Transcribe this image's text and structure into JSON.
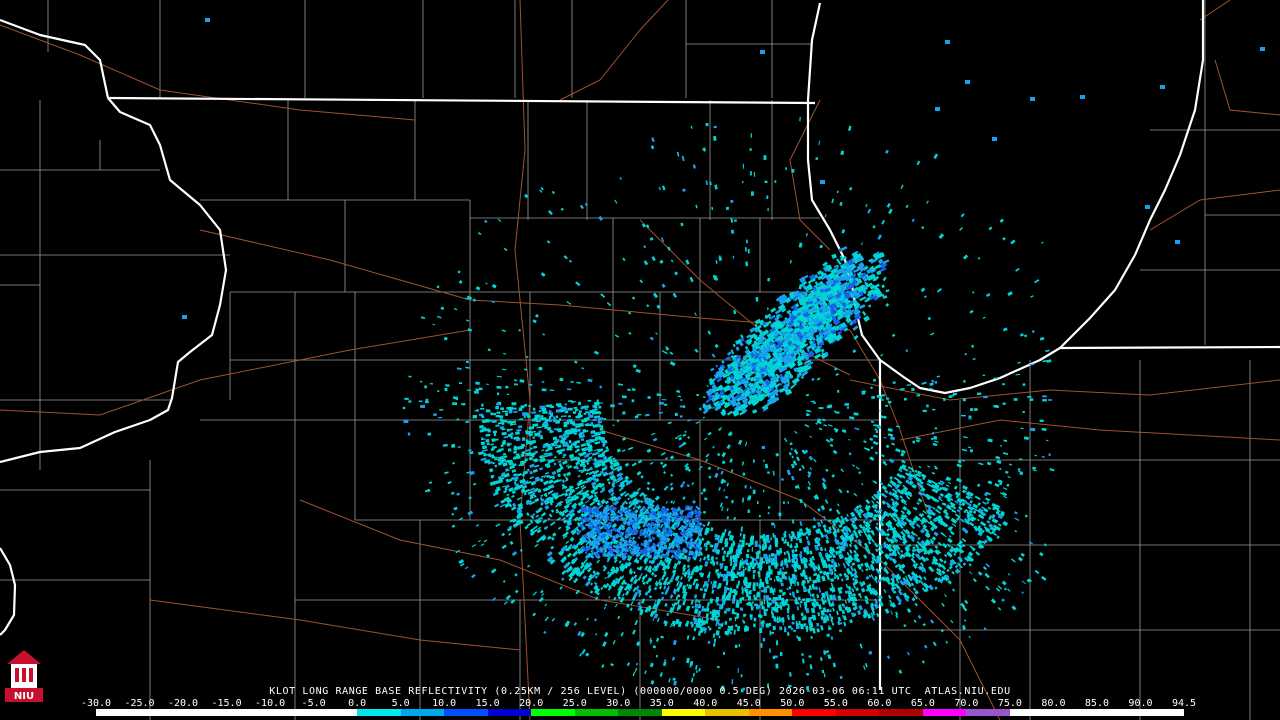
{
  "caption": "KLOT LONG RANGE BASE REFLECTIVITY (0.25KM / 256 LEVEL) (000000/0000 0.5 DEG) 2026-03-06 06:11 UTC  ATLAS.NIU.EDU",
  "logo_text": "NIU",
  "scale": {
    "labels": [
      "-30.0",
      "-25.0",
      "-20.0",
      "-15.0",
      "-10.0",
      "-5.0",
      "0.0",
      "5.0",
      "10.0",
      "15.0",
      "20.0",
      "25.0",
      "30.0",
      "35.0",
      "40.0",
      "45.0",
      "50.0",
      "55.0",
      "60.0",
      "65.0",
      "70.0",
      "75.0",
      "80.0",
      "85.0",
      "90.0",
      "94.5"
    ],
    "colors": [
      "#ffffff",
      "#ffffff",
      "#ffffff",
      "#ffffff",
      "#ffffff",
      "#ffffff",
      "#00e8e8",
      "#00a8f0",
      "#0050ff",
      "#0000d0",
      "#00ff00",
      "#00c000",
      "#008800",
      "#ffff00",
      "#e8c000",
      "#ff9000",
      "#ff0000",
      "#d00000",
      "#b00000",
      "#ff00ff",
      "#9955cc",
      "#ffffff",
      "#ffffff",
      "#ffffff",
      "#ffffff"
    ]
  },
  "colors": {
    "background": "#000000",
    "state_border": "#ffffff",
    "county_border": "#9a9a9a",
    "highway": "#a0522d",
    "echo_light": "#00d5d5",
    "echo_medium": "#1aa0ee",
    "echo_strong": "#1464e6"
  }
}
